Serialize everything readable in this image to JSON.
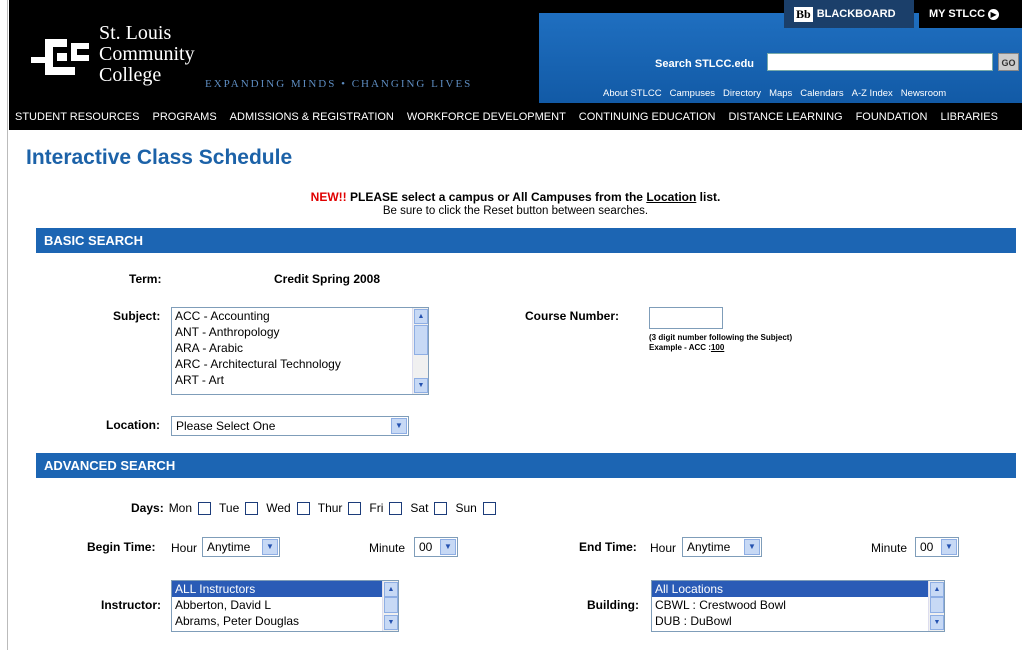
{
  "header": {
    "logo_lines": [
      "St. Louis",
      "Community",
      "College"
    ],
    "tagline": "EXPANDING MINDS • CHANGING LIVES",
    "blackboard_logo": "Bb",
    "blackboard_label": "BLACKBOARD",
    "mystlcc_label": "MY STLCC",
    "search_label": "Search STLCC.edu",
    "search_value": "",
    "go_label": "GO",
    "links": [
      "About STLCC",
      "Campuses",
      "Directory",
      "Maps",
      "Calendars",
      "A-Z Index",
      "Newsroom"
    ]
  },
  "nav": [
    "STUDENT RESOURCES",
    "PROGRAMS",
    "ADMISSIONS & REGISTRATION",
    "WORKFORCE DEVELOPMENT",
    "CONTINUING EDUCATION",
    "DISTANCE LEARNING",
    "FOUNDATION",
    "LIBRARIES"
  ],
  "page_title": "Interactive Class Schedule",
  "notice": {
    "new": "NEW!!",
    "text1": " PLEASE select a campus or All Campuses from the ",
    "link": "Location",
    "text2": " list.",
    "line2": "Be sure to click the Reset button between searches."
  },
  "basic": {
    "section_label": "BASIC SEARCH",
    "term_label": "Term:",
    "term_value": "Credit Spring 2008",
    "subject_label": "Subject:",
    "subjects": [
      "ACC - Accounting",
      "ANT - Anthropology",
      "ARA - Arabic",
      "ARC - Architectural Technology",
      "ART - Art"
    ],
    "course_number_label": "Course Number:",
    "course_number_value": "",
    "course_hint": "(3 digit number following the Subject)",
    "course_example": "Example - ACC :",
    "course_example_num": "100",
    "location_label": "Location:",
    "location_value": "Please Select One"
  },
  "advanced": {
    "section_label": "ADVANCED SEARCH",
    "days_label": "Days:",
    "days": [
      "Mon",
      "Tue",
      "Wed",
      "Thur",
      "Fri",
      "Sat",
      "Sun"
    ],
    "begin_label": "Begin Time:",
    "end_label": "End Time:",
    "hour_label": "Hour",
    "minute_label": "Minute",
    "begin_hour": "Anytime",
    "begin_minute": "00",
    "end_hour": "Anytime",
    "end_minute": "00",
    "instructor_label": "Instructor:",
    "instructors": [
      "ALL Instructors",
      "Abberton, David L",
      "Abrams, Peter Douglas"
    ],
    "building_label": "Building:",
    "buildings": [
      "All Locations",
      "CBWL : Crestwood Bowl",
      "DUB : DuBowl"
    ]
  }
}
